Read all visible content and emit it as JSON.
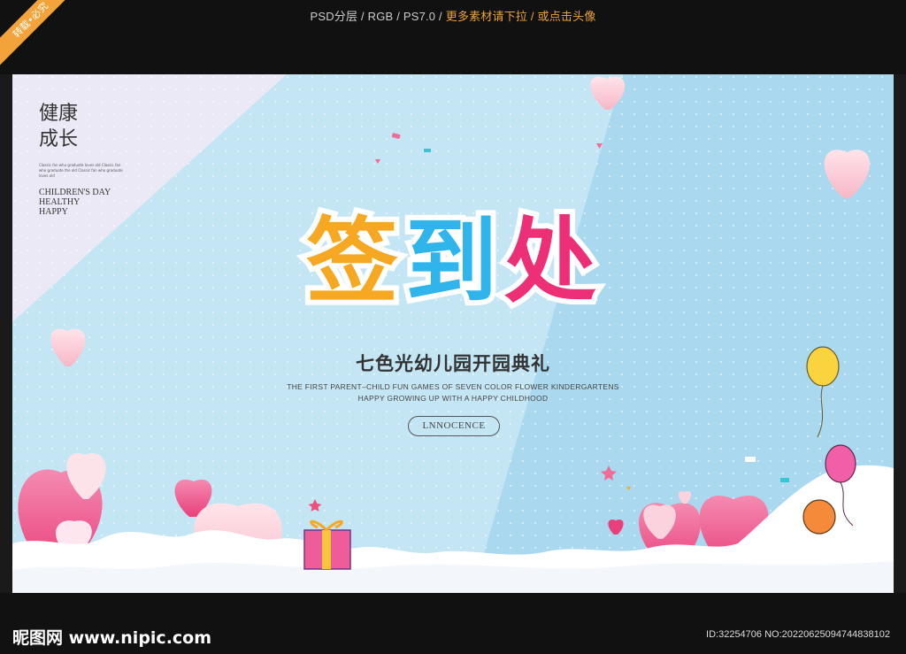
{
  "top_bar": {
    "meta": "PSD分层 / RGB / PS7.0 /",
    "more": "更多素材请下拉 / 或点击头像",
    "ribbon": "转载•必究"
  },
  "poster": {
    "side_title_line1": "健康",
    "side_title_line2": "成长",
    "side_small_text": "Classic fan who graduate loves old Classic fan who graduate the old Classic fan who graduate loves old",
    "side_en_line1": "CHILDREN'S DAY",
    "side_en_line2": "HEALTHY",
    "side_en_line3": "HAPPY",
    "main_title_1": "签",
    "main_title_2": "到",
    "main_title_3": "处",
    "subtitle": "七色光幼儿园开园典礼",
    "english_line1": "THE FIRST PARENT–CHILD FUN GAMES OF SEVEN COLOR FLOWER KINDERGARTENS",
    "english_line2": "HAPPY GROWING UP WITH A HAPPY CHILDHOOD",
    "pill_label": "LNNOCENCE"
  },
  "footer": {
    "logo": "昵图网 www.nipic.com",
    "id": "ID:32254706 NO:20220625094744838102"
  },
  "colors": {
    "title_orange": "#f7a823",
    "title_blue": "#2fb4ec",
    "title_pink": "#ec2f77",
    "background_blue": "#bfe1f1",
    "heart_pink": "#f06b96"
  }
}
